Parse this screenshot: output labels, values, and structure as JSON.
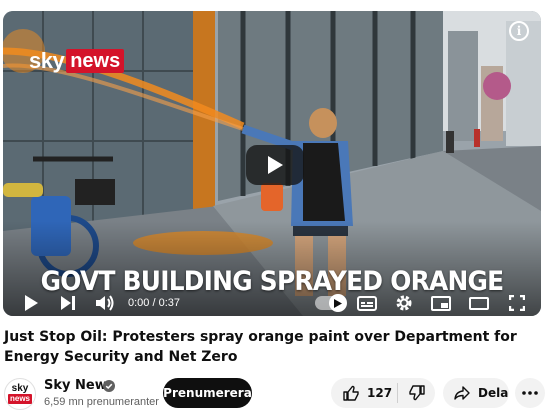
{
  "video": {
    "brand_logo": {
      "sky": "sky",
      "news": "news"
    },
    "caption": "GOVT BUILDING SPRAYED ORANGE",
    "time": "0:00 / 0:37",
    "info_icon_label": "i",
    "icons": [
      "play-icon",
      "next-icon",
      "volume-icon",
      "autoplay-toggle",
      "subtitles-icon",
      "settings-icon",
      "miniplayer-icon",
      "theater-icon",
      "fullscreen-icon",
      "info-icon"
    ]
  },
  "title": "Just Stop Oil: Protesters spray orange paint over Department for Energy Security and Net Zero",
  "channel": {
    "avatar_top": "sky",
    "avatar_bottom": "news",
    "name": "Sky News",
    "subscribers": "6,59 mn prenumeranter",
    "subscribe_label": "Prenumerera"
  },
  "actions": {
    "like_count": "127",
    "share_label": "Dela"
  },
  "colors": {
    "brand_red": "#d4132a",
    "spray_orange": "#f28b1e",
    "button_dark": "#0f0f0f",
    "button_light": "#f2f2f2"
  }
}
